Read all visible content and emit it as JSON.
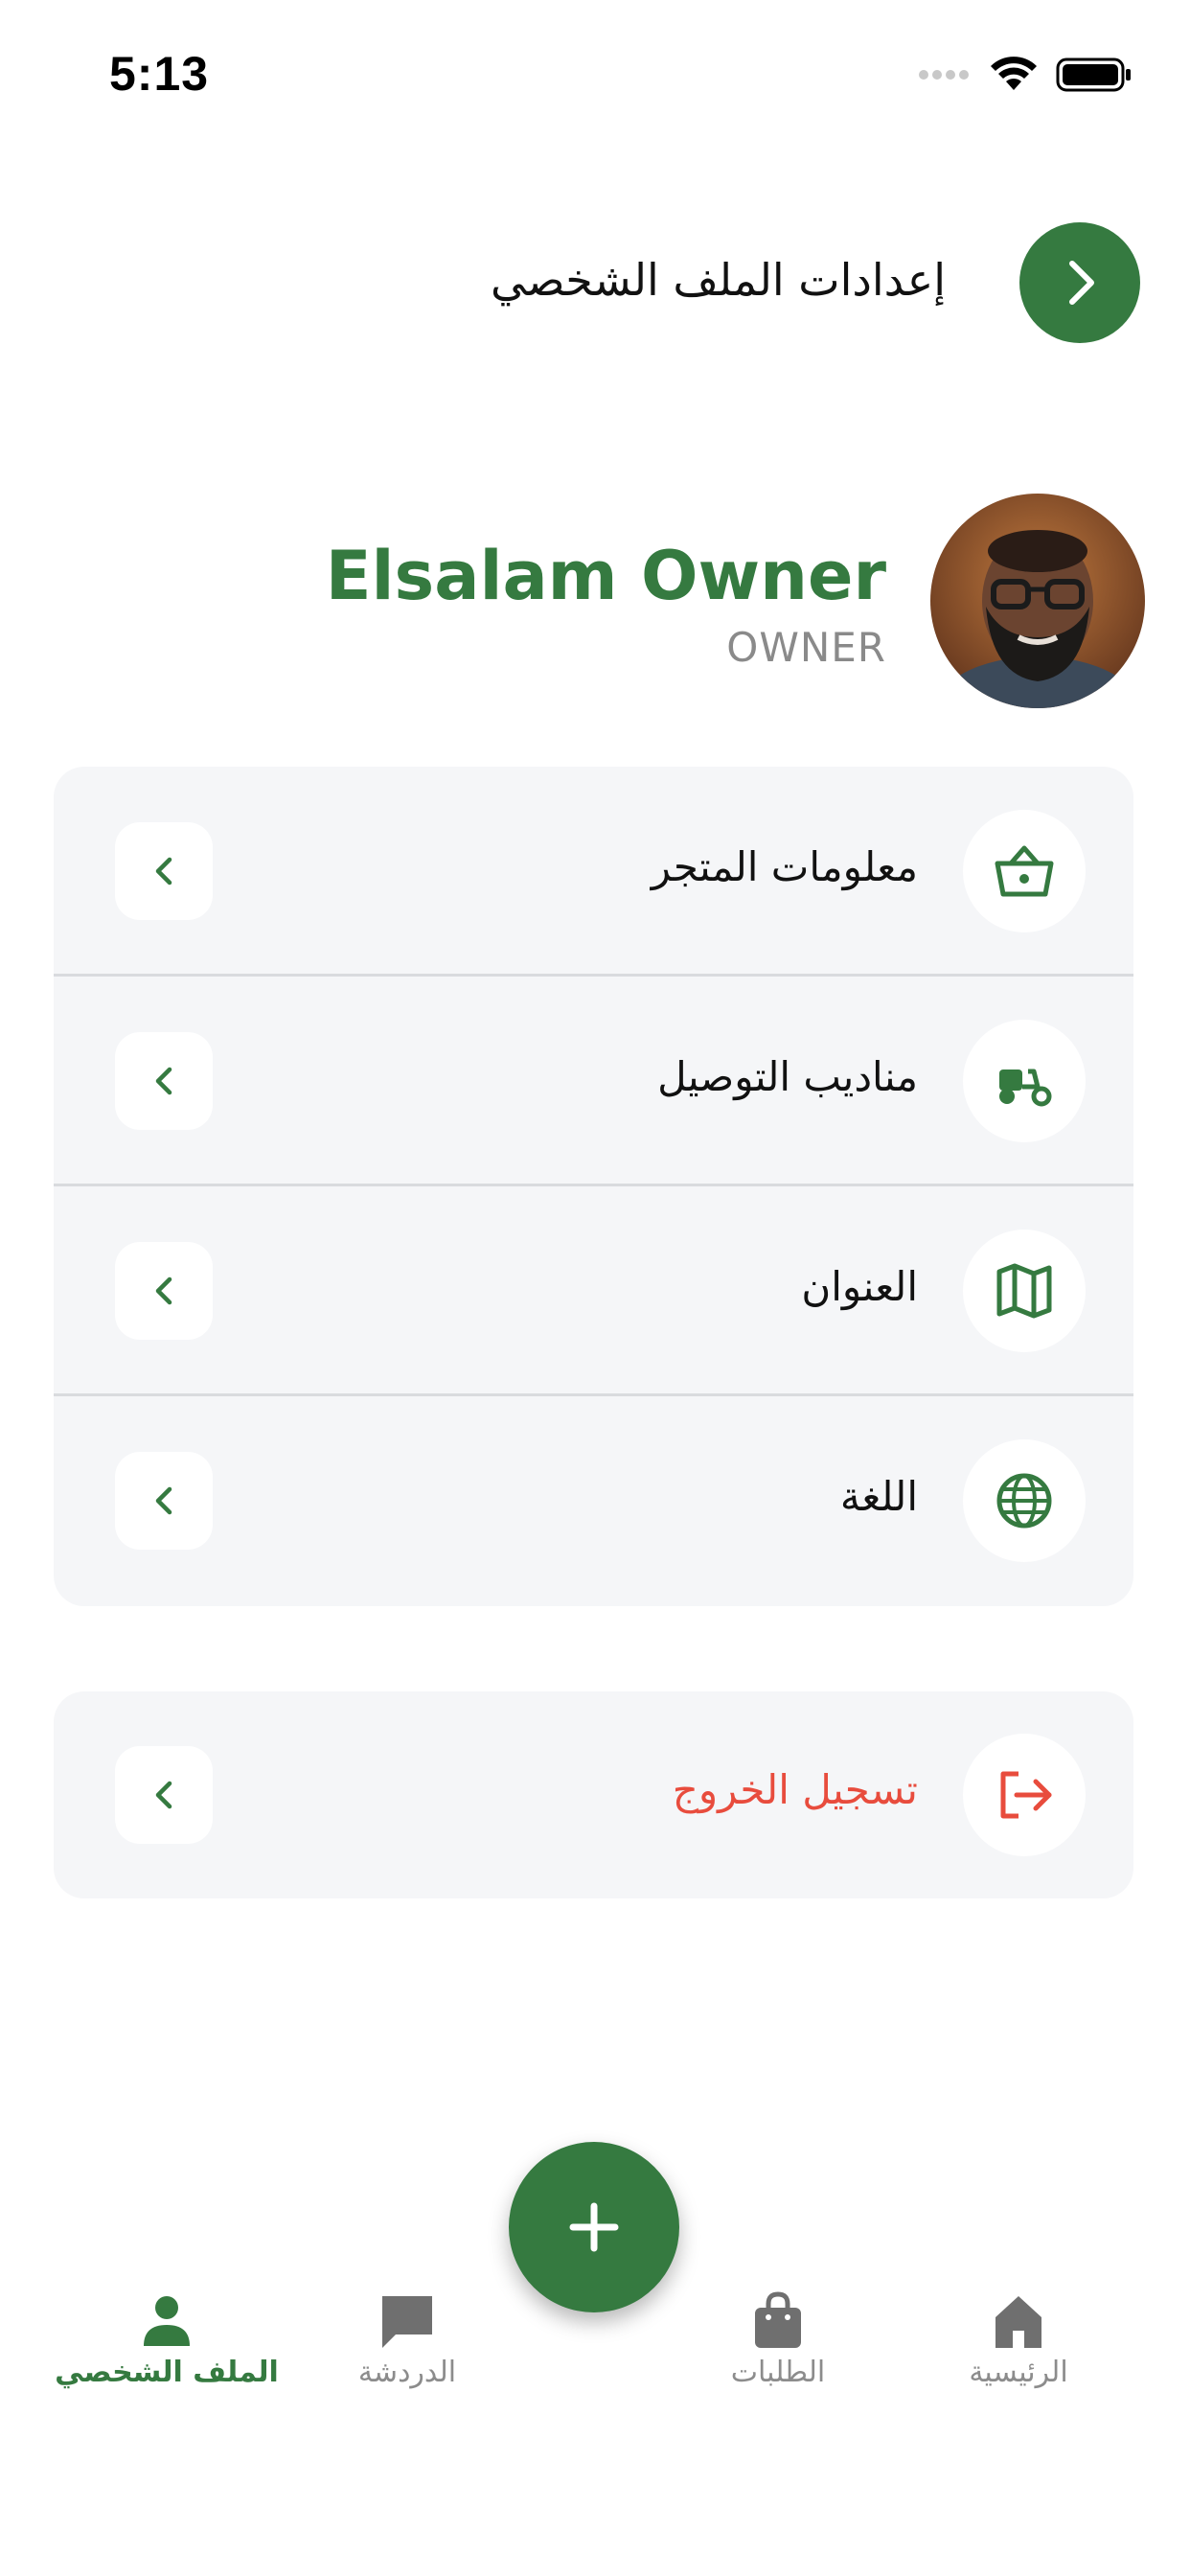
{
  "status_bar": {
    "time": "5:13"
  },
  "header": {
    "title": "إعدادات الملف الشخصي"
  },
  "profile": {
    "name": "Elsalam Owner",
    "role": "OWNER"
  },
  "menu": {
    "items": [
      {
        "label": "معلومات المتجر",
        "icon": "basket-icon"
      },
      {
        "label": "مناديب التوصيل",
        "icon": "scooter-icon"
      },
      {
        "label": "العنوان",
        "icon": "map-icon"
      },
      {
        "label": "اللغة",
        "icon": "globe-icon"
      }
    ]
  },
  "logout": {
    "label": "تسجيل الخروج",
    "icon": "logout-icon"
  },
  "bottom_nav": {
    "items": [
      {
        "label": "الملف الشخصي",
        "icon": "person-icon",
        "active": true
      },
      {
        "label": "الدردشة",
        "icon": "chat-icon",
        "active": false
      },
      {
        "label": "الطلبات",
        "icon": "bag-icon",
        "active": false
      },
      {
        "label": "الرئيسية",
        "icon": "home-icon",
        "active": false
      }
    ],
    "fab_icon": "plus-icon"
  },
  "colors": {
    "primary": "#357a40",
    "danger": "#e84c3d",
    "card_bg": "#f5f6f8",
    "muted": "#8c8c8c"
  }
}
